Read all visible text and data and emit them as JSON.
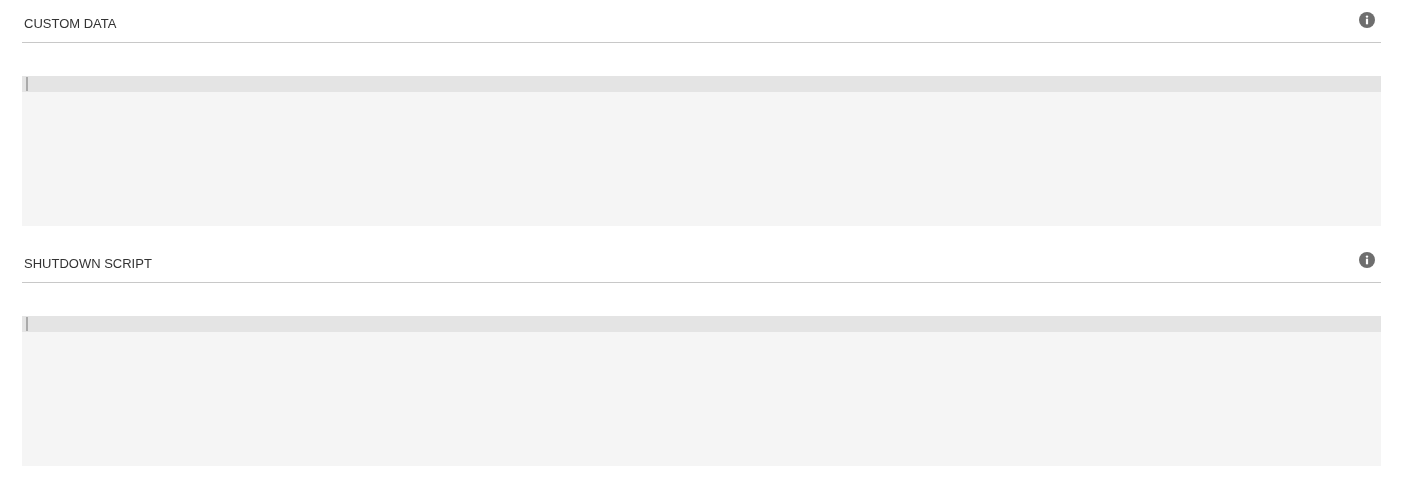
{
  "sections": [
    {
      "title": "CUSTOM DATA",
      "info_icon": true
    },
    {
      "title": "SHUTDOWN SCRIPT",
      "info_icon": true
    }
  ]
}
